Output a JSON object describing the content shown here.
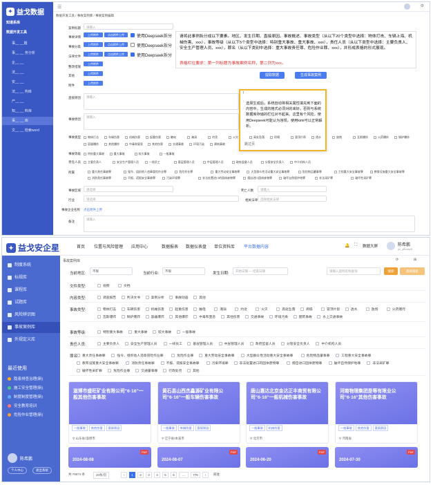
{
  "top": {
    "app_name": "益戈数据",
    "menu": [
      {
        "label": "知道系库",
        "type": "grp"
      },
      {
        "label": "数据开发工具",
        "type": "grp"
      },
      {
        "label": "事__  __题",
        "type": "sub"
      },
      {
        "label": "事__  __ 务分析",
        "type": "sub"
      },
      {
        "label": "企__  __",
        "type": "sub"
      },
      {
        "label": "法__  __",
        "type": "sub"
      },
      {
        "label": "安__  __",
        "type": "sub"
      },
      {
        "label": "法__  __ 构库",
        "type": "sub"
      },
      {
        "label": "产__  __",
        "type": "sub"
      },
      {
        "label": "知__  __ 料库",
        "type": "sub"
      },
      {
        "label": "事__  __ 库",
        "type": "sub"
      },
      {
        "label": "文__  __ 检索word",
        "type": "sub"
      }
    ],
    "breadcrumb": "数据开发工具 / 事故案例库 / 事故案例编辑",
    "labels": {
      "case_name": "案例标题",
      "accident_detail": "事故详情",
      "classification": "事故分类",
      "law": "法律文件",
      "correction": "整改措施",
      "other": "其他",
      "author": "附件",
      "summary": "直接原因",
      "cause": "事故原因",
      "accident_type": "事故类型",
      "accident_level": "事故等级",
      "responsible": "责任人员",
      "industry": "所属",
      "region": "事故区域",
      "quantity": "死亡人数",
      "industry2": "行业",
      "related": "相关法律",
      "exposure": "事故企业名称",
      "remark": "备注"
    },
    "upload_label": "上传附件",
    "upload2_label": "点击附件上传",
    "deepseek_label": "使用Deepseek拆分",
    "prompt_text": "请将此事例拆分成以下要素。地区、发生日期、直接原因、事故概述、事故类型（从以下20个类型中选择：物体打击、车辆上海、机械伤害、xxx），事故等级（从以下5个类型中选择：特别重大事故、重大事故、xxx），责任人员（从以下类型中选择：主要负责人、安全生产管理人员、xxx），罪名（从以下类别中选择：重大事故责任罪、危险作业罪、xxx），并形成表格的形式展现。",
    "red_text": "表格栏位要求：第一列标题为事故案例名称，第二列为xxx。",
    "btn_generate": "提取数据",
    "btn_generate2": "生成事故案例",
    "popup": {
      "title": "!",
      "body": "选择生成后，系统自动将相关属性填充到下面的内容中。生成的格式必须对的来好，否则与系统数据库存储的栏位对不起来。这里有个风险，使用Deepseek可能认为违规，使用kimi可以正常解析。",
      "footer": "跳过页"
    },
    "placeholder": "请输入",
    "types": [
      "物体打击",
      "车辆伤害",
      "机械伤害",
      "起重伤害",
      "触电",
      "淹溺",
      "灼烫",
      "火灾",
      "高处坠落",
      "坍塌",
      "冒顶片帮",
      "透水",
      "放炮",
      "瓦斯爆炸",
      "火药爆炸",
      "锅炉爆炸",
      "容器爆炸",
      "其他爆炸",
      "中毒和窒息",
      "其他伤害",
      "交通事故",
      "环境污染",
      "建筑事故"
    ],
    "levels": [
      "特别重大事故",
      "重大事故",
      "较大事故",
      "一般事故"
    ],
    "roles": [
      "主要负责人",
      "安全生产管理人员",
      "一线员工",
      "基层管理人员",
      "中层管理人员",
      "政府监督人员",
      "分管安全负责人",
      "中介机构人员"
    ],
    "crimes": [
      "重大责任事故罪",
      "强令、组织他人违章冒险作业罪",
      "危险作业罪",
      "重大劳动安全事故罪",
      "大型群众性活动重大安全事故罪",
      "危险物品肇事罪",
      "工程重大安全事故罪",
      "教育设施重大安全事故罪",
      "消防责任事故罪",
      "不报、谎报安全事故罪",
      "污染环境罪",
      "非法处置进口的固体废物罪",
      "擅自进口固体废物罪",
      "破坏自然保护地罪",
      "非法采矿罪",
      "破坏性采矿罪"
    ],
    "select_label": "请选择",
    "related_label": "选择相关法律"
  },
  "bot": {
    "app_name": "益戈安企星",
    "nav": [
      "首页",
      "位置与风险管理",
      "应用中心",
      "数据报表",
      "数据仪表盘",
      "单位资料库",
      "平台数据内容"
    ],
    "nav_active": 6,
    "right_labels": {
      "screen": "数据大屏",
      "user": "陈希鹏",
      "user_sub": "yx_yflease5"
    },
    "sidebar": [
      "制度系统",
      "标规库",
      "课程库",
      "试题库",
      "风险辨识图",
      "事故案例库",
      "外规定义库"
    ],
    "sidebar_active": 5,
    "recent_title": "最近使用",
    "recent": [
      {
        "label": "隐患排查治理(新)",
        "color": "#ffb020"
      },
      {
        "label": "施工安全管理(新)",
        "color": "#4cd080"
      },
      {
        "label": "制度制度管理(新)",
        "color": "#5ab0ff"
      },
      {
        "label": "安全教育培训",
        "color": "#ff7a7a"
      },
      {
        "label": "危险作业管理(新)",
        "color": "#ff9a3a"
      }
    ],
    "footer_user": "陈希鹏",
    "footer_btn1": "个人中心",
    "footer_btn2": "退出系统",
    "breadcrumb": "事故案例库",
    "filter": {
      "region_label": "当前地区:",
      "region_val": "不限",
      "industry_label": "当前行业:",
      "industry_val": "不限",
      "date_label": "发生日期:",
      "date_from": "开始日期",
      "date_to": "结束日期",
      "search_placeholder": "请输入案例名称查询",
      "search_btn": "搜索",
      "adv_btn": "高级搜索"
    },
    "rows": [
      {
        "label": "文件类型:",
        "opts": [
          "视频",
          "文档"
        ]
      },
      {
        "label": "内容类型:",
        "opts": [
          "调查报告",
          "判决文书",
          "案例分析",
          "事故动画",
          "其他"
        ]
      },
      {
        "label": "事故类型:",
        "opts": [
          "物体打击",
          "车辆伤害",
          "机械伤害",
          "起重伤害",
          "触电",
          "淹溺",
          "灼烫",
          "火灾",
          "高处坠落",
          "坍塌",
          "冒顶片帮",
          "透水",
          "放炮",
          "火药爆炸",
          "瓦斯爆炸",
          "锅炉爆炸",
          "容器爆炸",
          "其他爆炸",
          "中毒和窒息",
          "其他伤害",
          "交通事故",
          "环境污染",
          "建筑事故",
          "水上交通事故"
        ]
      },
      {
        "label": "事故等级:",
        "opts": [
          "特别重大事故",
          "重大事故",
          "较大事故",
          "一般事故"
        ]
      },
      {
        "label": "责任人员:",
        "opts": [
          "主要负责人",
          "安全生产管理人员",
          "一线员工",
          "基层管理人员",
          "中层管理人员",
          "政府监督人员",
          "分管安全负责人",
          "中介机构人员"
        ]
      },
      {
        "label": "罪名:",
        "opts": [
          "重大责任事故罪",
          "强令、组织他人违章冒险作业罪",
          "危险作业罪",
          "重大劳动安全事故罪",
          "大型群众性活动重大安全事故罪",
          "危险物品肇事罪",
          "工程重大安全事故罪",
          "教育设施重大安全事故罪",
          "消防责任事故罪",
          "不报、谎报安全事故罪",
          "污染环境罪",
          "非法处置进口的固体废物罪",
          "擅自进口固体废物罪",
          "破坏自然保护地罪",
          "非法采矿罪",
          "破坏性采矿罪",
          "危险作业罪",
          "交通肇事罪",
          "行政处罚",
          "其他"
        ]
      }
    ],
    "cards": [
      {
        "title": "滋博市盛旺矿业有限公司\"6·16\"一般其他伤害事故",
        "tags": [
          "一般事故",
          "其他伤害",
          "直接原因"
        ],
        "loc": "山东省/淄博市"
      },
      {
        "title": "黄石县山西杰鑫源矿业有限公司\"6·16\"一般车辆伤害事故",
        "tags": [
          "一般事故",
          "车辆伤害",
          "直接原因"
        ],
        "loc": "辽宁省/本溪市"
      },
      {
        "title": "唐山惠达北京金达正丰商贸有限公司\"6·16\"一般机械伤害事故",
        "tags": [
          "一般事故",
          "机械伤害"
        ],
        "loc": "北京市"
      },
      {
        "title": "河南物理集团是等有限业公司\"6·16\"其他伤害事故",
        "tags": [
          "一般事故",
          "其他伤害",
          "直接原因"
        ],
        "loc": "河南省"
      }
    ],
    "cards2": [
      "2024-08-08",
      "2024-08-07",
      "2024-06-20",
      "2024-07-30"
    ],
    "pdf_label": "PDF",
    "pager": {
      "total": "共 79574 条",
      "per_page": "20条/页",
      "pages": [
        "1",
        "2",
        "3",
        "4",
        "5",
        "6",
        "...",
        "776"
      ],
      "active": 0,
      "goto": "前往"
    }
  }
}
